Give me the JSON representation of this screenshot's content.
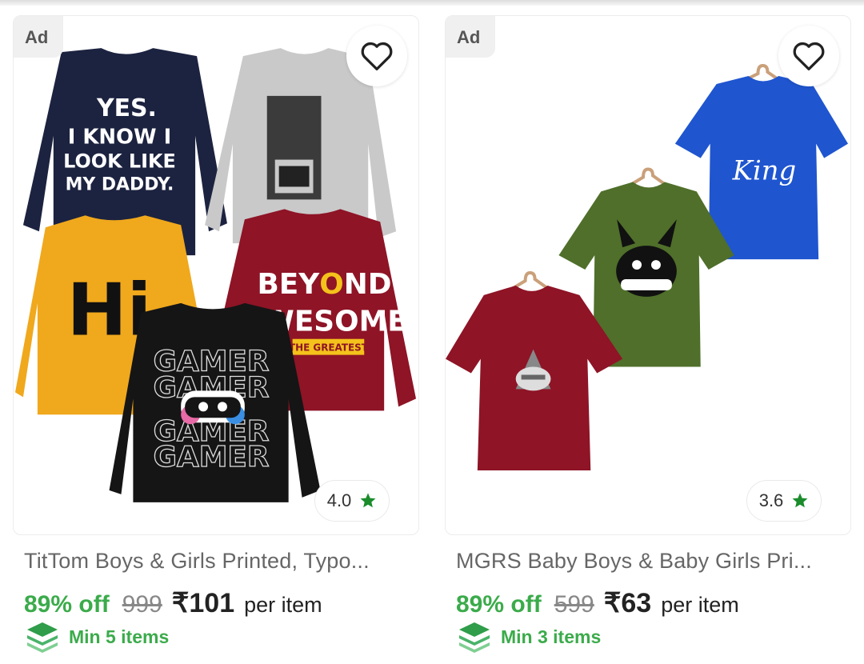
{
  "products": [
    {
      "ad_label": "Ad",
      "wishlist_icon": "heart-outline-icon",
      "rating": "4.0",
      "rating_icon": "star-icon",
      "title": "TitTom Boys & Girls Printed, Typo...",
      "discount": "89% off",
      "mrp": "999",
      "price": "₹101",
      "per_unit": "per item",
      "min_icon": "layers-icon",
      "min_qty": "Min 5 items",
      "image_text": {
        "shirt1": [
          "YES.",
          "I KNOW I",
          "LOOK LIKE",
          "MY DADDY."
        ],
        "shirt3": "Hi",
        "shirt4": [
          "BEY",
          "O",
          "ND"
        ],
        "shirt4b": "AWESOME",
        "shirt4c": "THE GREATEST",
        "shirt5": "GAMER"
      }
    },
    {
      "ad_label": "Ad",
      "wishlist_icon": "heart-outline-icon",
      "rating": "3.6",
      "rating_icon": "star-icon",
      "title": "MGRS Baby Boys & Baby Girls Pri...",
      "discount": "89% off",
      "mrp": "599",
      "price": "₹63",
      "per_unit": "per item",
      "min_icon": "layers-icon",
      "min_qty": "Min 3 items",
      "image_text": {
        "blue_shirt": "King"
      }
    }
  ],
  "colors": {
    "accent_green": "#3bab4b",
    "star_green": "#1a8c2b",
    "navy": "#1c2340",
    "grey_shirt": "#c9c9c9",
    "mustard": "#f0a81c",
    "maroon": "#8e1426",
    "royal_blue": "#1f55cf",
    "olive": "#4f6f2a"
  }
}
